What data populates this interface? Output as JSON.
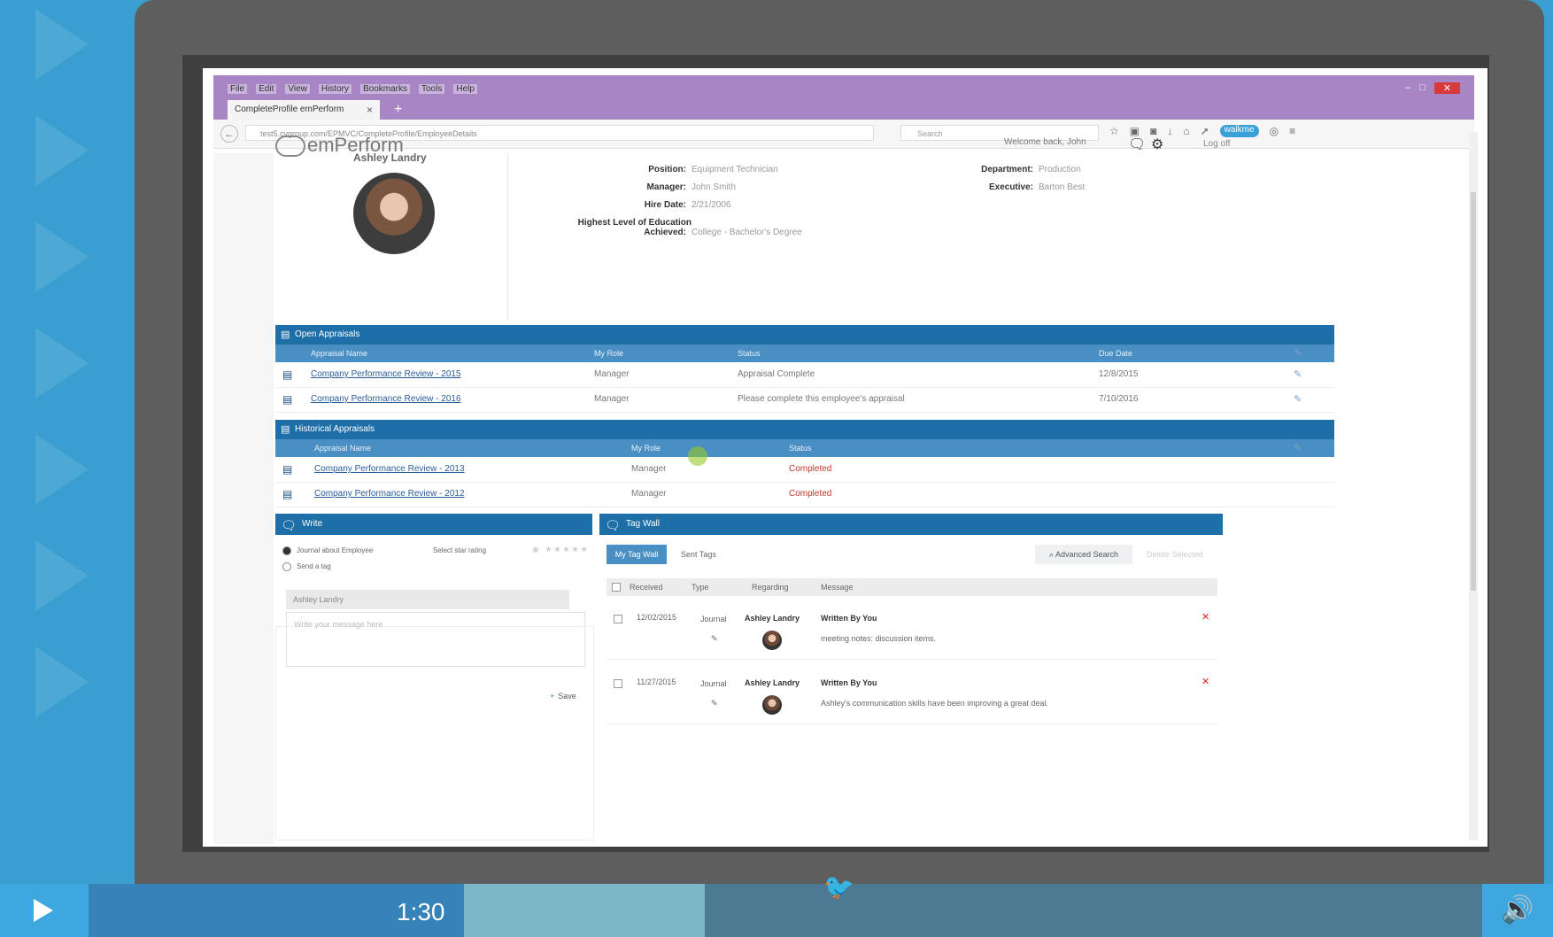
{
  "browser": {
    "menu": [
      "File",
      "Edit",
      "View",
      "History",
      "Bookmarks",
      "Tools",
      "Help"
    ],
    "tab_title": "CompleteProfile emPerform",
    "url": "test5.cvgroup.com/EPMVC/CompleteProfile/EmployeeDetails",
    "search_placeholder": "Search",
    "walkme": "walkme"
  },
  "app": {
    "logo": "emPerform",
    "welcome": "Welcome back, John",
    "logoff": "Log off"
  },
  "profile": {
    "name": "Ashley Landry",
    "fields": [
      {
        "label": "Position:",
        "value": "Equipment Technician"
      },
      {
        "label": "Manager:",
        "value": "John Smith"
      },
      {
        "label": "Hire Date:",
        "value": "2/21/2006"
      },
      {
        "label": "Highest Level of Education Achieved:",
        "value": "College - Bachelor's Degree"
      }
    ],
    "right_fields": [
      {
        "label": "Department:",
        "value": "Production"
      },
      {
        "label": "Executive:",
        "value": "Barton Best"
      }
    ]
  },
  "open_appraisals": {
    "title": "Open Appraisals",
    "columns": [
      "Appraisal Name",
      "My Role",
      "Status",
      "Due Date"
    ],
    "rows": [
      {
        "name": "Company Performance Review - 2015",
        "role": "Manager",
        "status": "Appraisal Complete",
        "due": "12/8/2015"
      },
      {
        "name": "Company Performance Review - 2016",
        "role": "Manager",
        "status": "Please complete this employee's appraisal",
        "due": "7/10/2016"
      }
    ]
  },
  "historical_appraisals": {
    "title": "Historical Appraisals",
    "columns": [
      "Appraisal Name",
      "My Role",
      "Status"
    ],
    "rows": [
      {
        "name": "Company Performance Review - 2013",
        "role": "Manager",
        "status": "Completed"
      },
      {
        "name": "Company Performance Review - 2012",
        "role": "Manager",
        "status": "Completed"
      }
    ]
  },
  "write": {
    "title": "Write",
    "option_journal": "Journal about Employee",
    "option_tag": "Send a tag",
    "star_label": "Select star rating",
    "tag_input": "Ashley Landry",
    "message_placeholder": "Write your message here",
    "save": "Save"
  },
  "tag_wall": {
    "title": "Tag Wall",
    "tab_active": "My Tag Wall",
    "tab_sent": "Sent Tags",
    "advanced_search": "Advanced Search",
    "delete_selected": "Delete Selected",
    "columns": [
      "Received",
      "Type",
      "Regarding",
      "Message"
    ],
    "rows": [
      {
        "date": "12/02/2015",
        "type": "Journal",
        "regarding": "Ashley Landry",
        "author": "Written By You",
        "message": "meeting notes: discussion items."
      },
      {
        "date": "11/27/2015",
        "type": "Journal",
        "regarding": "Ashley Landry",
        "author": "Written By You",
        "message": "Ashley's communication skills have been improving a great deal."
      }
    ]
  },
  "player": {
    "time": "1:30",
    "progress_fraction": 0.27
  },
  "colors": {
    "background": "#3a9fd0",
    "titlebar": "#a886c6",
    "section_header": "#1e6ea8",
    "completed": "#c0392b"
  }
}
